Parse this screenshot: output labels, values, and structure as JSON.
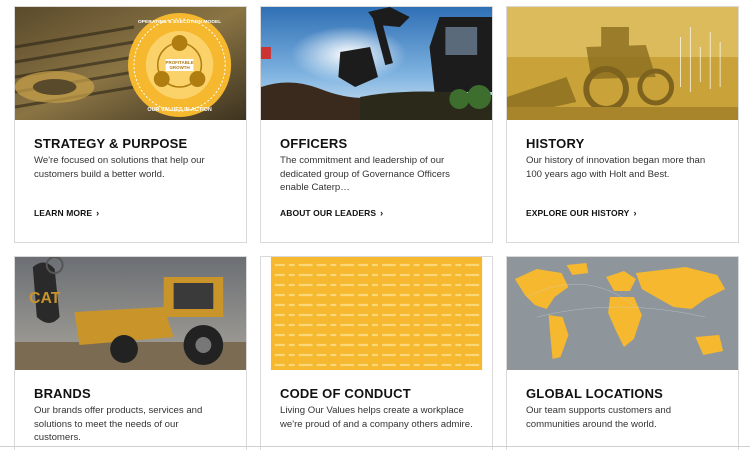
{
  "cards": [
    {
      "title": "STRATEGY & PURPOSE",
      "text": "We're focused on solutions that help our customers build a better world.",
      "link": "LEARN MORE",
      "image_icon": "strategy-badge",
      "badge_top": "OPERATING & EXECUTION MODEL",
      "badge_center": "PROFITABLE GROWTH",
      "badge_bottom": "OUR VALUES IN ACTION"
    },
    {
      "title": "OFFICERS",
      "text": "The commitment and leadership of our dedicated group of Governance Officers enable Caterp…",
      "link": "ABOUT OUR LEADERS",
      "image_icon": "excavator-photo"
    },
    {
      "title": "HISTORY",
      "text": "Our history of innovation began more than 100 years ago with Holt and Best.",
      "link": "EXPLORE OUR HISTORY",
      "image_icon": "vintage-tractor-photo"
    },
    {
      "title": "BRANDS",
      "text": "Our brands offer products, services and solutions to meet the needs of our customers.",
      "image_icon": "backhoe-loader-photo"
    },
    {
      "title": "CODE OF CONDUCT",
      "text": "Living Our Values helps create a workplace we're proud of and a company others admire.",
      "image_icon": "multilingual-text-pattern"
    },
    {
      "title": "GLOBAL LOCATIONS",
      "text": "Our team supports customers and communities around the world.",
      "image_icon": "world-map"
    }
  ],
  "chevron": "›",
  "colors": {
    "cat_yellow": "#f5b82e",
    "text_dark": "#111111",
    "border": "#d9d9d9"
  }
}
